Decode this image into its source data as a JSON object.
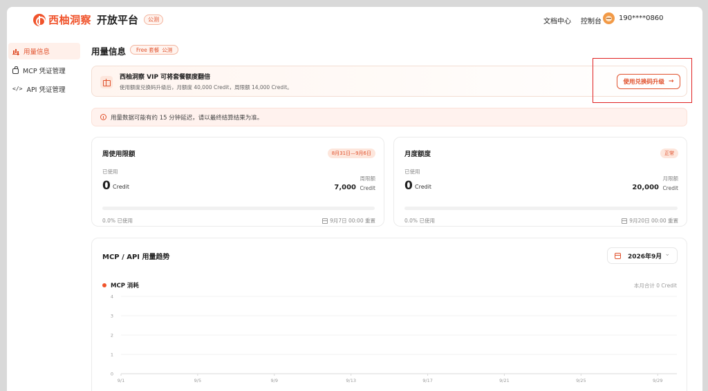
{
  "header": {
    "brand": "西柚洞察",
    "platform": "开放平台",
    "beta_badge": "公测",
    "nav": [
      "文档中心",
      "控制台"
    ],
    "user_phone": "190****0860"
  },
  "sidebar": {
    "items": [
      {
        "label": "用量信息",
        "icon": "bar-chart-icon",
        "active": true
      },
      {
        "label": "MCP 凭证管理",
        "icon": "key-icon",
        "active": false
      },
      {
        "label": "API 凭证管理",
        "icon": "code-icon",
        "active": false
      }
    ]
  },
  "main": {
    "title": "用量信息",
    "plan_badge": {
      "plan": "Free 套餐",
      "status": "公测"
    },
    "banner": {
      "title": "西柚洞察 VIP 可将套餐额度翻倍",
      "subtitle": "使用额度兑换码升级后，月额度 40,000 Credit，周限额 14,000 Credit。",
      "button_label": "使用兑换码升级",
      "button_arrow": "→"
    },
    "notice": "用量数据可能有约 15 分钟延迟，请以最终结算结果为准。",
    "weekly": {
      "title": "周使用限额",
      "badge": "8月31日—9月6日",
      "used_label": "已使用",
      "used_value": "0",
      "unit": "Credit",
      "limit_label": "周限额",
      "limit_value": "7,000",
      "progress": 0,
      "percent_text": "0.0% 已使用",
      "reset_text": "9月7日 00:00 重置"
    },
    "monthly": {
      "title": "月度额度",
      "badge": "正常",
      "used_label": "已使用",
      "used_value": "0",
      "unit": "Credit",
      "limit_label": "月限额",
      "limit_value": "20,000",
      "progress": 0,
      "percent_text": "0.0% 已使用",
      "reset_text": "9月20日 00:00 重置"
    },
    "trend": {
      "title": "MCP / API 用量趋势",
      "month_value": "2026年9月",
      "legend_label": "MCP 消耗",
      "month_total": "本月合计 0 Credit"
    }
  },
  "colors": {
    "accent": "#e0502b",
    "series": "#f0532b",
    "highlight_box": "#e02020"
  },
  "chart_data": {
    "type": "line",
    "categories": [
      "9/1",
      "9/2",
      "9/3",
      "9/4",
      "9/5",
      "9/6",
      "9/7",
      "9/8",
      "9/9",
      "9/10",
      "9/11",
      "9/12",
      "9/13",
      "9/14",
      "9/15",
      "9/16",
      "9/17",
      "9/18",
      "9/19",
      "9/20",
      "9/21",
      "9/22",
      "9/23",
      "9/24",
      "9/25",
      "9/26",
      "9/27",
      "9/28",
      "9/29",
      "9/30"
    ],
    "x_tick_labels": [
      "9/1",
      "9/5",
      "9/9",
      "9/13",
      "9/17",
      "9/21",
      "9/25",
      "9/29"
    ],
    "series": [
      {
        "name": "MCP 消耗",
        "values": [
          0,
          0,
          0,
          0,
          0,
          0,
          0,
          0,
          0,
          0,
          0,
          0,
          0,
          0,
          0,
          0,
          0,
          0,
          0,
          0,
          0,
          0,
          0,
          0,
          0,
          0,
          0,
          0,
          0,
          0
        ]
      }
    ],
    "ylim": [
      0,
      4
    ],
    "y_ticks": [
      0,
      1,
      2,
      3,
      4
    ],
    "grid": true,
    "legend": "top-left"
  }
}
